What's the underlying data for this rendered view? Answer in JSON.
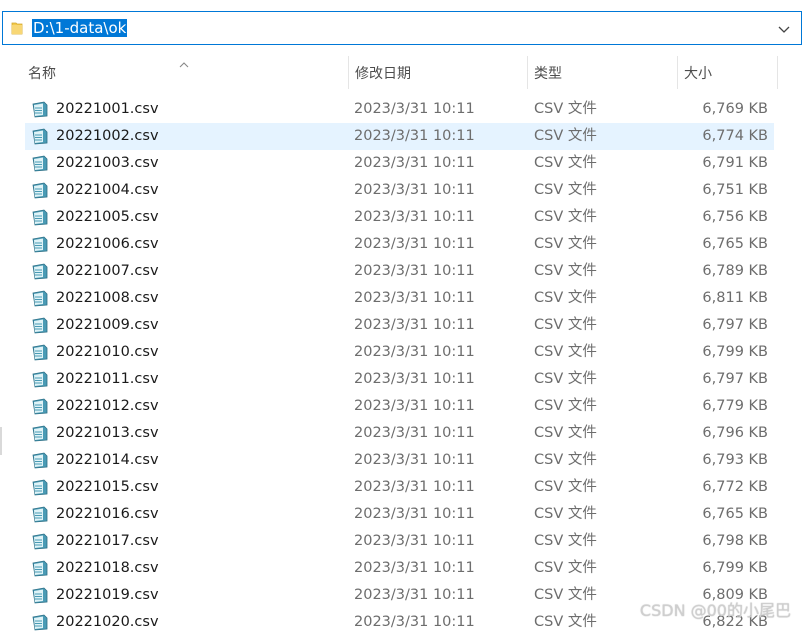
{
  "address_bar": {
    "path": "D:\\1-data\\ok",
    "folder_icon": "folder-icon",
    "dropdown_icon": "chevron-down-icon"
  },
  "columns": {
    "name": "名称",
    "date": "修改日期",
    "type": "类型",
    "size": "大小",
    "sort_icon": "sort-ascending-icon"
  },
  "files": [
    {
      "name": "20221001.csv",
      "date": "2023/3/31 10:11",
      "type": "CSV 文件",
      "size": "6,769 KB"
    },
    {
      "name": "20221002.csv",
      "date": "2023/3/31 10:11",
      "type": "CSV 文件",
      "size": "6,774 KB",
      "selected": true
    },
    {
      "name": "20221003.csv",
      "date": "2023/3/31 10:11",
      "type": "CSV 文件",
      "size": "6,791 KB"
    },
    {
      "name": "20221004.csv",
      "date": "2023/3/31 10:11",
      "type": "CSV 文件",
      "size": "6,751 KB"
    },
    {
      "name": "20221005.csv",
      "date": "2023/3/31 10:11",
      "type": "CSV 文件",
      "size": "6,756 KB"
    },
    {
      "name": "20221006.csv",
      "date": "2023/3/31 10:11",
      "type": "CSV 文件",
      "size": "6,765 KB"
    },
    {
      "name": "20221007.csv",
      "date": "2023/3/31 10:11",
      "type": "CSV 文件",
      "size": "6,789 KB"
    },
    {
      "name": "20221008.csv",
      "date": "2023/3/31 10:11",
      "type": "CSV 文件",
      "size": "6,811 KB"
    },
    {
      "name": "20221009.csv",
      "date": "2023/3/31 10:11",
      "type": "CSV 文件",
      "size": "6,797 KB"
    },
    {
      "name": "20221010.csv",
      "date": "2023/3/31 10:11",
      "type": "CSV 文件",
      "size": "6,799 KB"
    },
    {
      "name": "20221011.csv",
      "date": "2023/3/31 10:11",
      "type": "CSV 文件",
      "size": "6,797 KB"
    },
    {
      "name": "20221012.csv",
      "date": "2023/3/31 10:11",
      "type": "CSV 文件",
      "size": "6,779 KB"
    },
    {
      "name": "20221013.csv",
      "date": "2023/3/31 10:11",
      "type": "CSV 文件",
      "size": "6,796 KB"
    },
    {
      "name": "20221014.csv",
      "date": "2023/3/31 10:11",
      "type": "CSV 文件",
      "size": "6,793 KB"
    },
    {
      "name": "20221015.csv",
      "date": "2023/3/31 10:11",
      "type": "CSV 文件",
      "size": "6,772 KB"
    },
    {
      "name": "20221016.csv",
      "date": "2023/3/31 10:11",
      "type": "CSV 文件",
      "size": "6,765 KB"
    },
    {
      "name": "20221017.csv",
      "date": "2023/3/31 10:11",
      "type": "CSV 文件",
      "size": "6,798 KB"
    },
    {
      "name": "20221018.csv",
      "date": "2023/3/31 10:11",
      "type": "CSV 文件",
      "size": "6,799 KB"
    },
    {
      "name": "20221019.csv",
      "date": "2023/3/31 10:11",
      "type": "CSV 文件",
      "size": "6,809 KB"
    },
    {
      "name": "20221020.csv",
      "date": "2023/3/31 10:11",
      "type": "CSV 文件",
      "size": "6,822 KB"
    }
  ],
  "file_icon": "csv-file-icon",
  "watermark": "CSDN @00的小尾巴",
  "colors": {
    "accent": "#0078d7",
    "selected_row": "#e5f3ff",
    "secondary_text": "#6d6d6d"
  }
}
